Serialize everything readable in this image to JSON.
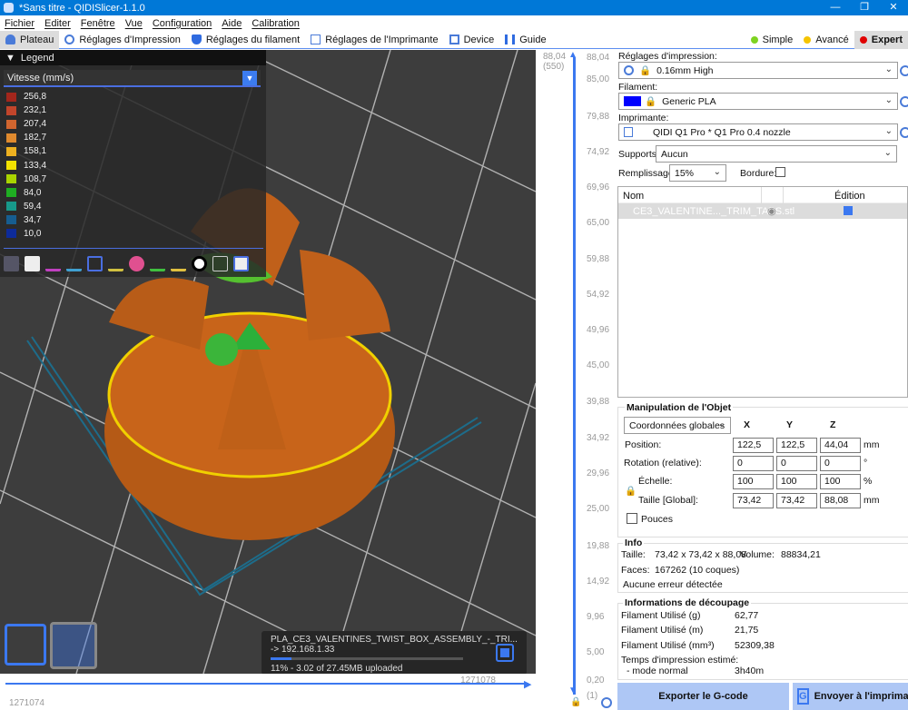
{
  "window": {
    "title": "*Sans titre - QIDISlicer-1.1.0",
    "minimize": "—",
    "maximize": "❐",
    "close": "✕"
  },
  "menu": [
    "Fichier",
    "Editer",
    "Fenêtre",
    "Vue",
    "Configuration",
    "Aide",
    "Calibration"
  ],
  "tabs": [
    {
      "label": "Plateau",
      "icon": "plate-icon",
      "active": true
    },
    {
      "label": "Réglages d'Impression",
      "icon": "gear-icon"
    },
    {
      "label": "Réglages du filament",
      "icon": "filament-icon"
    },
    {
      "label": "Réglages de l'Imprimante",
      "icon": "printer-icon"
    },
    {
      "label": "Device",
      "icon": "device-icon"
    },
    {
      "label": "Guide",
      "icon": "guide-icon"
    }
  ],
  "modes": [
    {
      "label": "Simple",
      "color": "#7ed321"
    },
    {
      "label": "Avancé",
      "color": "#f5c400"
    },
    {
      "label": "Expert",
      "color": "#e00000",
      "active": true
    }
  ],
  "legend": {
    "title": "Legend",
    "view_type": "Vitesse (mm/s)",
    "items": [
      {
        "value": "256,8",
        "color": "#a3261c"
      },
      {
        "value": "232,1",
        "color": "#c2452b"
      },
      {
        "value": "207,4",
        "color": "#d1652f"
      },
      {
        "value": "182,7",
        "color": "#e08a2e"
      },
      {
        "value": "158,1",
        "color": "#eeb120"
      },
      {
        "value": "133,4",
        "color": "#f3e200"
      },
      {
        "value": "108,7",
        "color": "#a9d400"
      },
      {
        "value": "84,0",
        "color": "#1fae22"
      },
      {
        "value": "59,4",
        "color": "#17998a"
      },
      {
        "value": "34,7",
        "color": "#165d90"
      },
      {
        "value": "10,0",
        "color": "#0d2b9a"
      }
    ]
  },
  "upload": {
    "filename": "PLA_CE3_VALENTINES_TWIST_BOX_ASSEMBLY_-_TRI...",
    "target": "-> 192.168.1.33",
    "progress_percent": 11,
    "status": "11% - 3.02 of 27.45MB uploaded"
  },
  "hslider": {
    "left_value": "1271074",
    "right_value": "1271078"
  },
  "vslider": {
    "top_value": "88,04",
    "top_layer": "(550)",
    "bottom_value": "0,20",
    "bottom_layer": "(1)",
    "ticks": [
      "88,04",
      "85,00",
      "79,88",
      "74,92",
      "69,96",
      "65,00",
      "59,88",
      "54,92",
      "49,96",
      "45,00",
      "39,88",
      "34,92",
      "29,96",
      "25,00",
      "19,88",
      "14,92",
      "9,96",
      "5,00",
      "0,20"
    ]
  },
  "settings": {
    "print_label": "Réglages d'impression:",
    "print_value": "0.16mm High",
    "filament_label": "Filament:",
    "filament_value": "Generic PLA",
    "filament_color": "#0000ff",
    "printer_label": "Imprimante:",
    "printer_value": "QIDI Q1 Pro * Q1 Pro 0.4 nozzle",
    "supports_label": "Supports:",
    "supports_value": "Aucun",
    "infill_label": "Remplissage:",
    "infill_value": "15%",
    "brim_label": "Bordure:"
  },
  "objects": {
    "col_name": "Nom",
    "col_edit": "Édition",
    "rows": [
      {
        "name": "CE3_VALENTINE..._TRIM_TABS.stl"
      }
    ]
  },
  "manip": {
    "title": "Manipulation de l'Objet",
    "coords": "Coordonnées globales",
    "axes": [
      "X",
      "Y",
      "Z"
    ],
    "position_label": "Position:",
    "position": [
      "122,5",
      "122,5",
      "44,04"
    ],
    "position_unit": "mm",
    "rotation_label": "Rotation (relative):",
    "rotation": [
      "0",
      "0",
      "0"
    ],
    "rotation_unit": "°",
    "scale_label": "Échelle:",
    "scale": [
      "100",
      "100",
      "100"
    ],
    "scale_unit": "%",
    "size_label": "Taille [Global]:",
    "size": [
      "73,42",
      "73,42",
      "88,08"
    ],
    "size_unit": "mm",
    "inches_label": "Pouces"
  },
  "info": {
    "title": "Info",
    "size_label": "Taille:",
    "size": "73,42 x 73,42 x 88,08",
    "volume_label": "Volume:",
    "volume": "88834,21",
    "faces_label": "Faces:",
    "faces": "167262 (10 coques)",
    "errors": "Aucune erreur détectée"
  },
  "slice": {
    "title": "Informations de découpage",
    "rows": [
      {
        "label": "Filament Utilisé (g)",
        "value": "62,77"
      },
      {
        "label": "Filament Utilisé (m)",
        "value": "21,75"
      },
      {
        "label": "Filament Utilisé (mm³)",
        "value": "52309,38"
      }
    ],
    "time_label": "Temps d'impression estimé:",
    "mode_label": "- mode normal",
    "mode_value": "3h40m"
  },
  "buttons": {
    "export": "Exporter le G-code",
    "send": "Envoyer à l'imprimante"
  }
}
